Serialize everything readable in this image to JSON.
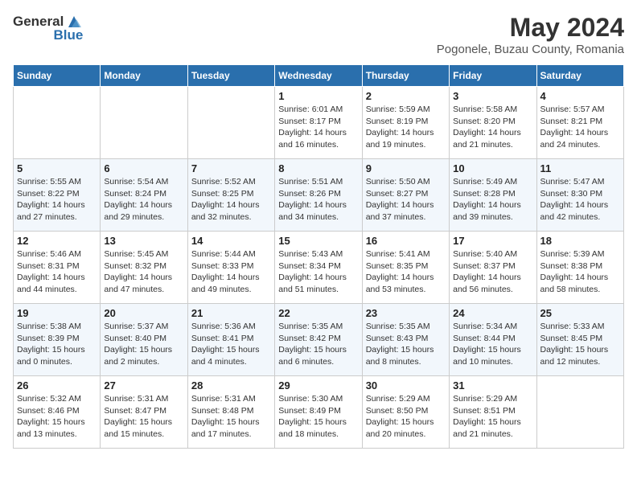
{
  "header": {
    "logo_general": "General",
    "logo_blue": "Blue",
    "title": "May 2024",
    "subtitle": "Pogonele, Buzau County, Romania"
  },
  "days_of_week": [
    "Sunday",
    "Monday",
    "Tuesday",
    "Wednesday",
    "Thursday",
    "Friday",
    "Saturday"
  ],
  "weeks": [
    [
      {
        "day": "",
        "info": ""
      },
      {
        "day": "",
        "info": ""
      },
      {
        "day": "",
        "info": ""
      },
      {
        "day": "1",
        "info": "Sunrise: 6:01 AM\nSunset: 8:17 PM\nDaylight: 14 hours\nand 16 minutes."
      },
      {
        "day": "2",
        "info": "Sunrise: 5:59 AM\nSunset: 8:19 PM\nDaylight: 14 hours\nand 19 minutes."
      },
      {
        "day": "3",
        "info": "Sunrise: 5:58 AM\nSunset: 8:20 PM\nDaylight: 14 hours\nand 21 minutes."
      },
      {
        "day": "4",
        "info": "Sunrise: 5:57 AM\nSunset: 8:21 PM\nDaylight: 14 hours\nand 24 minutes."
      }
    ],
    [
      {
        "day": "5",
        "info": "Sunrise: 5:55 AM\nSunset: 8:22 PM\nDaylight: 14 hours\nand 27 minutes."
      },
      {
        "day": "6",
        "info": "Sunrise: 5:54 AM\nSunset: 8:24 PM\nDaylight: 14 hours\nand 29 minutes."
      },
      {
        "day": "7",
        "info": "Sunrise: 5:52 AM\nSunset: 8:25 PM\nDaylight: 14 hours\nand 32 minutes."
      },
      {
        "day": "8",
        "info": "Sunrise: 5:51 AM\nSunset: 8:26 PM\nDaylight: 14 hours\nand 34 minutes."
      },
      {
        "day": "9",
        "info": "Sunrise: 5:50 AM\nSunset: 8:27 PM\nDaylight: 14 hours\nand 37 minutes."
      },
      {
        "day": "10",
        "info": "Sunrise: 5:49 AM\nSunset: 8:28 PM\nDaylight: 14 hours\nand 39 minutes."
      },
      {
        "day": "11",
        "info": "Sunrise: 5:47 AM\nSunset: 8:30 PM\nDaylight: 14 hours\nand 42 minutes."
      }
    ],
    [
      {
        "day": "12",
        "info": "Sunrise: 5:46 AM\nSunset: 8:31 PM\nDaylight: 14 hours\nand 44 minutes."
      },
      {
        "day": "13",
        "info": "Sunrise: 5:45 AM\nSunset: 8:32 PM\nDaylight: 14 hours\nand 47 minutes."
      },
      {
        "day": "14",
        "info": "Sunrise: 5:44 AM\nSunset: 8:33 PM\nDaylight: 14 hours\nand 49 minutes."
      },
      {
        "day": "15",
        "info": "Sunrise: 5:43 AM\nSunset: 8:34 PM\nDaylight: 14 hours\nand 51 minutes."
      },
      {
        "day": "16",
        "info": "Sunrise: 5:41 AM\nSunset: 8:35 PM\nDaylight: 14 hours\nand 53 minutes."
      },
      {
        "day": "17",
        "info": "Sunrise: 5:40 AM\nSunset: 8:37 PM\nDaylight: 14 hours\nand 56 minutes."
      },
      {
        "day": "18",
        "info": "Sunrise: 5:39 AM\nSunset: 8:38 PM\nDaylight: 14 hours\nand 58 minutes."
      }
    ],
    [
      {
        "day": "19",
        "info": "Sunrise: 5:38 AM\nSunset: 8:39 PM\nDaylight: 15 hours\nand 0 minutes."
      },
      {
        "day": "20",
        "info": "Sunrise: 5:37 AM\nSunset: 8:40 PM\nDaylight: 15 hours\nand 2 minutes."
      },
      {
        "day": "21",
        "info": "Sunrise: 5:36 AM\nSunset: 8:41 PM\nDaylight: 15 hours\nand 4 minutes."
      },
      {
        "day": "22",
        "info": "Sunrise: 5:35 AM\nSunset: 8:42 PM\nDaylight: 15 hours\nand 6 minutes."
      },
      {
        "day": "23",
        "info": "Sunrise: 5:35 AM\nSunset: 8:43 PM\nDaylight: 15 hours\nand 8 minutes."
      },
      {
        "day": "24",
        "info": "Sunrise: 5:34 AM\nSunset: 8:44 PM\nDaylight: 15 hours\nand 10 minutes."
      },
      {
        "day": "25",
        "info": "Sunrise: 5:33 AM\nSunset: 8:45 PM\nDaylight: 15 hours\nand 12 minutes."
      }
    ],
    [
      {
        "day": "26",
        "info": "Sunrise: 5:32 AM\nSunset: 8:46 PM\nDaylight: 15 hours\nand 13 minutes."
      },
      {
        "day": "27",
        "info": "Sunrise: 5:31 AM\nSunset: 8:47 PM\nDaylight: 15 hours\nand 15 minutes."
      },
      {
        "day": "28",
        "info": "Sunrise: 5:31 AM\nSunset: 8:48 PM\nDaylight: 15 hours\nand 17 minutes."
      },
      {
        "day": "29",
        "info": "Sunrise: 5:30 AM\nSunset: 8:49 PM\nDaylight: 15 hours\nand 18 minutes."
      },
      {
        "day": "30",
        "info": "Sunrise: 5:29 AM\nSunset: 8:50 PM\nDaylight: 15 hours\nand 20 minutes."
      },
      {
        "day": "31",
        "info": "Sunrise: 5:29 AM\nSunset: 8:51 PM\nDaylight: 15 hours\nand 21 minutes."
      },
      {
        "day": "",
        "info": ""
      }
    ]
  ]
}
